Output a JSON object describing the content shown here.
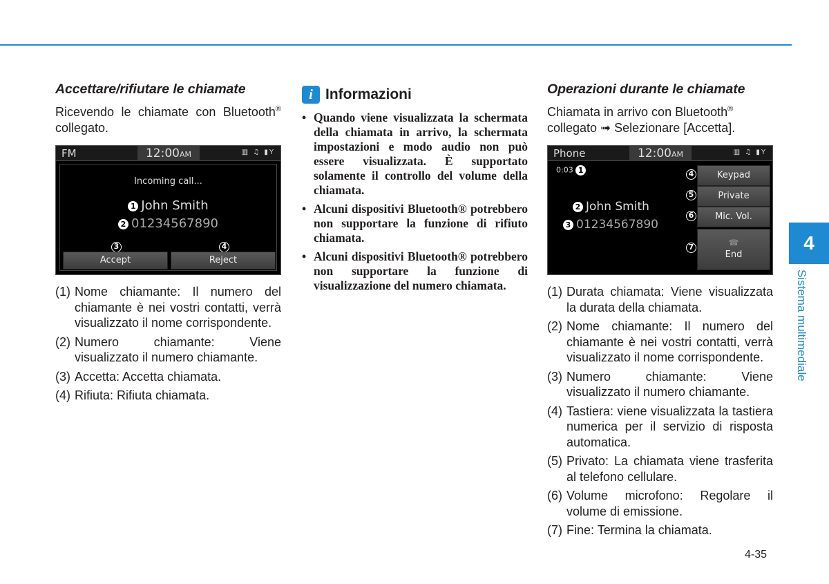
{
  "colors": {
    "accent": "#1f8ad1"
  },
  "col1": {
    "title": "Accettare/rifiutare le chiamate",
    "intro": "Ricevendo le chiamate con Bluetooth",
    "intro_sup": "®",
    "intro_end": " collegato.",
    "screen": {
      "source": "FM",
      "time": "12:00",
      "ampm": "AM",
      "status_icons": "▥ ♫ ▮Y",
      "message": "Incoming call...",
      "name": "John Smith",
      "number": "01234567890",
      "accept": "Accept",
      "reject": "Reject",
      "markers": [
        "1",
        "2",
        "3",
        "4"
      ]
    },
    "items": [
      {
        "n": "(1)",
        "t": "Nome chiamante: Il numero del chiamante è nei vostri contatti, verrà visualizzato il nome corrispondente."
      },
      {
        "n": "(2)",
        "t": "Numero chiamante: Viene visualizzato il numero chiamante."
      },
      {
        "n": "(3)",
        "t": "Accetta: Accetta chiamata."
      },
      {
        "n": "(4)",
        "t": "Rifiuta: Rifiuta chiamata."
      }
    ]
  },
  "col2": {
    "icon": "i",
    "title": "Informazioni",
    "bullets": [
      "Quando viene visualizzata la schermata della chiamata in arrivo, la schermata impostazioni e modo audio non può essere visualizzata. È supportato solamente il controllo del volume della chiamata.",
      "Alcuni dispositivi Bluetooth® potrebbero non supportare la funzione di rifiuto chiamata.",
      "Alcuni dispositivi Bluetooth® potrebbero non supportare la funzione di visualizzazione del numero chiamata."
    ]
  },
  "col3": {
    "title": "Operazioni durante le chiamate",
    "intro": "Chiamata in arrivo con Bluetooth",
    "intro_sup": "®",
    "intro_end": " collegato ➟ Selezionare [Accetta].",
    "screen": {
      "source": "Phone",
      "time": "12:00",
      "ampm": "AM",
      "status_icons": "▥ ♫ ▮Y",
      "duration": "0:03",
      "name": "John Smith",
      "number": "01234567890",
      "keypad": "Keypad",
      "private": "Private",
      "mic": "Mic. Vol.",
      "end": "End",
      "end_icon": "☎",
      "markers": [
        "1",
        "2",
        "3",
        "4",
        "5",
        "6",
        "7"
      ]
    },
    "items": [
      {
        "n": "(1)",
        "t": "Durata chiamata: Viene visualizzata la durata della chiamata."
      },
      {
        "n": "(2)",
        "t": "Nome chiamante: Il numero del chiamante è nei vostri contatti, verrà visualizzato il nome corrispondente."
      },
      {
        "n": "(3)",
        "t": "Numero chiamante: Viene visualizzato il numero chiamante."
      },
      {
        "n": "(4)",
        "t": "Tastiera: viene visualizzata la tastiera numerica per il servizio di risposta automatica."
      },
      {
        "n": "(5)",
        "t": "Privato: La chiamata viene trasferita al telefono cellulare."
      },
      {
        "n": "(6)",
        "t": "Volume microfono: Regolare il volume di emissione."
      },
      {
        "n": "(7)",
        "t": "Fine: Termina la chiamata."
      }
    ]
  },
  "side": {
    "chapter": "4",
    "label": "Sistema multimediale"
  },
  "page_number": "4-35"
}
